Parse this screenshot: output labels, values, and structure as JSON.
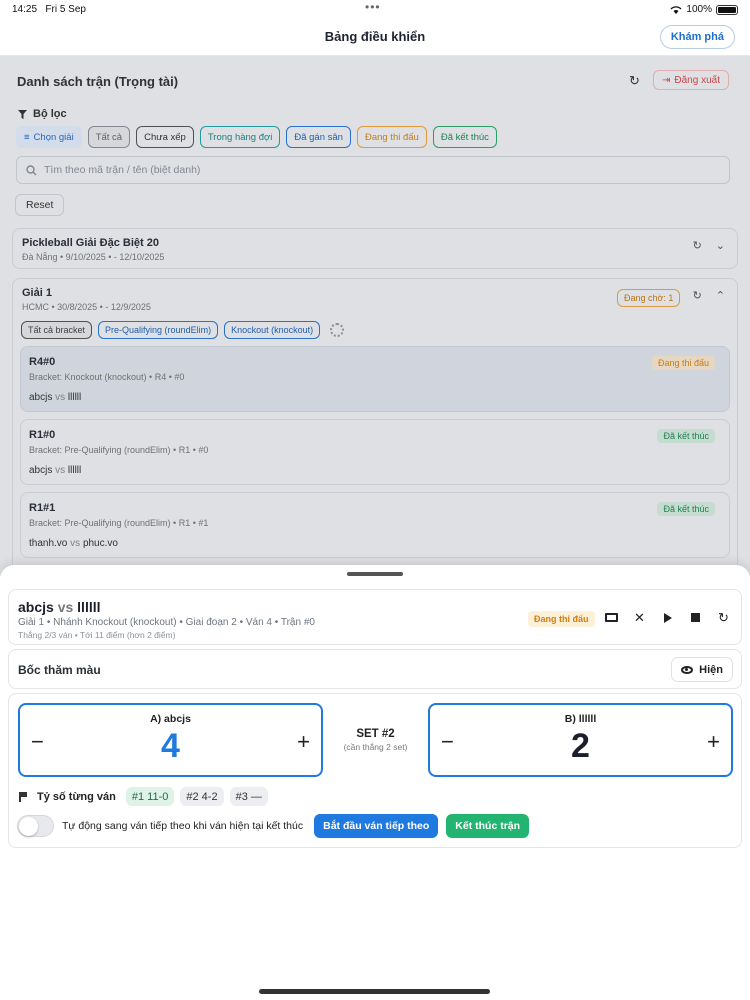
{
  "status": {
    "time": "14:25",
    "date": "Fri 5 Sep",
    "battery": "100%"
  },
  "nav": {
    "title": "Bảng điều khiển",
    "explore": "Khám phá"
  },
  "list": {
    "title": "Danh sách trận (Trọng tài)",
    "logout": "Đăng xuất",
    "filter_label": "Bộ lọc",
    "chips": {
      "select_tournament": "Chọn giải",
      "all": "Tất cả",
      "unscheduled": "Chưa xếp",
      "queued": "Trong hàng đợi",
      "assigned": "Đã gán sân",
      "live": "Đang thi đấu",
      "finished": "Đã kết thúc"
    },
    "search_placeholder": "Tìm theo mã trận / tên (biệt danh)",
    "reset": "Reset"
  },
  "tournaments": [
    {
      "name": "Pickleball Giải Đặc Biệt 20",
      "meta": "Đà Nẵng • 9/10/2025 • - 12/10/2025"
    },
    {
      "name": "Giải 1",
      "meta": "HCMC • 30/8/2025 • - 12/9/2025",
      "waiting": "Đang chờ: 1",
      "brackets": {
        "all": "Tất cả bracket",
        "b1": "Pre-Qualifying (roundElim)",
        "b2": "Knockout (knockout)"
      }
    }
  ],
  "matches": [
    {
      "code": "R4#0",
      "bracket": "Bracket: Knockout (knockout) • R4 • #0",
      "team_a": "abcjs",
      "vs": "vs",
      "team_b": "llllll",
      "status": "Đang thi đấu"
    },
    {
      "code": "R1#0",
      "bracket": "Bracket: Pre-Qualifying (roundElim) • R1 • #0",
      "team_a": "abcjs",
      "vs": "vs",
      "team_b": "llllll",
      "status": "Đã kết thúc"
    },
    {
      "code": "R1#1",
      "bracket": "Bracket: Pre-Qualifying (roundElim) • R1 • #1",
      "team_a": "thanh.vo",
      "vs": "vs",
      "team_b": "phuc.vo",
      "status": "Đã kết thúc"
    }
  ],
  "sheet": {
    "team_a": "abcjs",
    "vs": "vs",
    "team_b": "llllll",
    "info": "Giải 1 • Nhánh Knockout (knockout) • Giai đoạn 2 • Ván 4 • Trận #0",
    "rules": "Thắng 2/3 ván • Tới 11 điểm (hơn 2 điểm)",
    "status": "Đang thi đấu",
    "toss_title": "Bốc thăm màu",
    "show": "Hiện",
    "side_a_label": "A) abcjs",
    "side_b_label": "B) llllll",
    "score_a": "4",
    "score_b": "2",
    "set_title": "SET #2",
    "set_sub": "(cần thắng 2 set)",
    "game_scores_label": "Tỷ số từng ván",
    "game_scores": [
      "#1 11-0",
      "#2 4-2",
      "#3 —"
    ],
    "auto_next_label": "Tự động sang ván tiếp theo khi ván hiện tại kết thúc",
    "auto_next_on": false,
    "start_next": "Bắt đầu ván tiếp theo",
    "end_match": "Kết thúc trận"
  },
  "colors": {
    "accent": "#1f7ae0",
    "success": "#22b470",
    "warning": "#d08010",
    "danger": "#d94b4b"
  }
}
